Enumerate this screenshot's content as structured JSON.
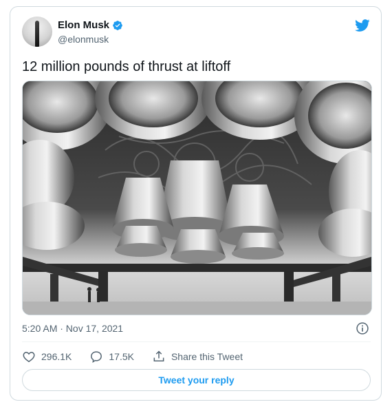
{
  "author": {
    "name": "Elon Musk",
    "handle": "@elonmusk",
    "avatar_icon": "avatar-photo",
    "verified_icon": "verified-badge-icon"
  },
  "brand_icon": "twitter-bird-icon",
  "tweet": {
    "text": "12 million pounds of thrust at liftoff",
    "media_description_icon": "rocket-engines-photo",
    "timestamp": "5:20 AM · Nov 17, 2021"
  },
  "actions": {
    "likes": "296.1K",
    "replies": "17.5K",
    "share_label": "Share this Tweet"
  },
  "reply_button_label": "Tweet your reply",
  "colors": {
    "accent": "#1d9bf0",
    "text_secondary": "#536471",
    "border": "#cfd9de"
  }
}
